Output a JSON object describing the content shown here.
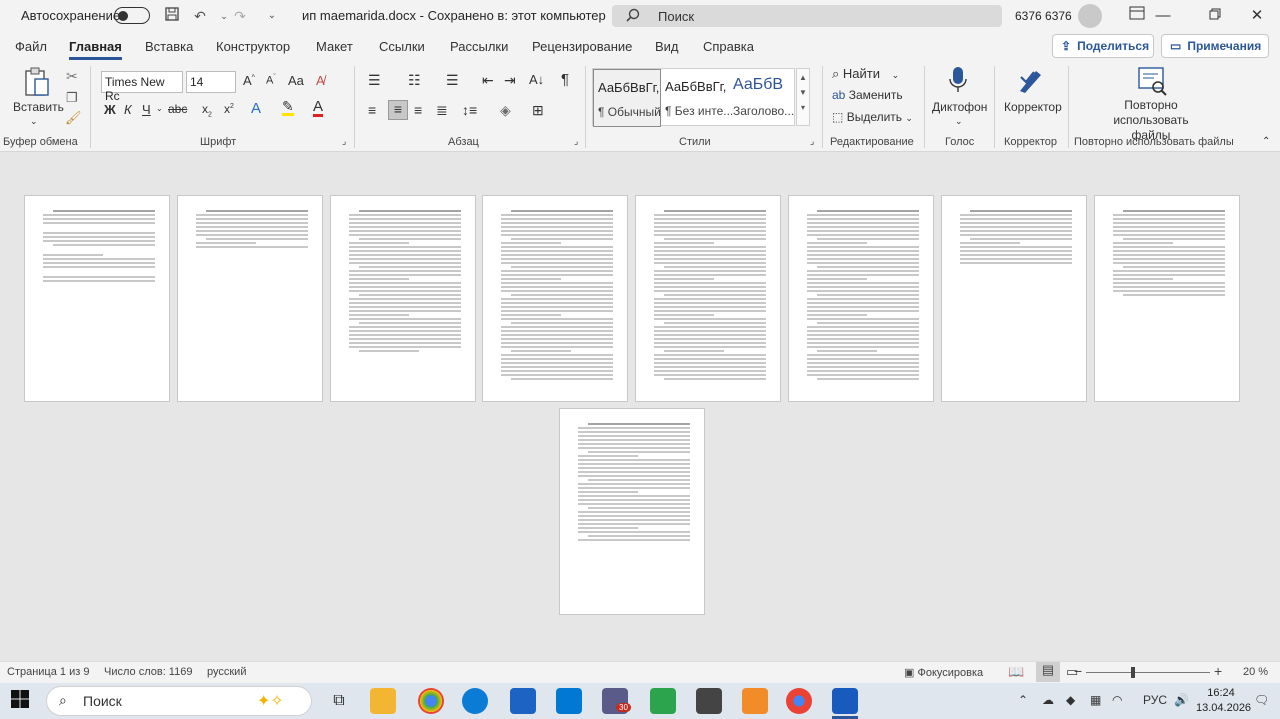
{
  "titlebar": {
    "autosave_label": "Автосохранение",
    "document_title": "ип maemarida.docx  -  Сохранено в: этот компьютер  ⌄",
    "search_placeholder": "Поиск",
    "user_name": "6376 6376"
  },
  "menu": {
    "tabs": [
      "Файл",
      "Главная",
      "Вставка",
      "Конструктор",
      "Макет",
      "Ссылки",
      "Рассылки",
      "Рецензирование",
      "Вид",
      "Справка"
    ],
    "share_label": "Поделиться",
    "comments_label": "Примечания"
  },
  "ribbon": {
    "clipboard": {
      "paste_label": "Вставить",
      "group_label": "Буфер обмена"
    },
    "font": {
      "font_name": "Times New Rc",
      "font_size": "14",
      "group_label": "Шрифт"
    },
    "paragraph": {
      "group_label": "Абзац"
    },
    "styles": {
      "items": [
        {
          "preview": "АаБбВвГг,",
          "name": "¶ Обычный"
        },
        {
          "preview": "АаБбВвГг,",
          "name": "¶ Без инте..."
        },
        {
          "preview": "АаБбВ",
          "name": "Заголово..."
        }
      ],
      "group_label": "Стили"
    },
    "editing": {
      "find": "Найти",
      "replace": "Заменить",
      "select": "Выделить",
      "group_label": "Редактирование"
    },
    "voice": {
      "dictate": "Диктофон",
      "group_label": "Голос"
    },
    "editor": {
      "label": "Корректор",
      "group_label": "Корректор"
    },
    "reuse": {
      "label": "Повторно использовать файлы",
      "group_label": "Повторно использовать файлы"
    }
  },
  "statusbar": {
    "page": "Страница 1 из 9",
    "words": "Число слов: 1169",
    "language": "русский",
    "focus": "Фокусировка",
    "zoom": "20 %",
    "zoom_value": 20
  },
  "taskbar": {
    "search_placeholder": "Поиск",
    "badge_count": "30",
    "language": "РУС",
    "time": "16:24",
    "date": "13.04.2026"
  },
  "colors": {
    "accent": "#2b579a",
    "ribbon_bg": "#f3f3f3",
    "canvas_bg": "#e6e6e6"
  }
}
